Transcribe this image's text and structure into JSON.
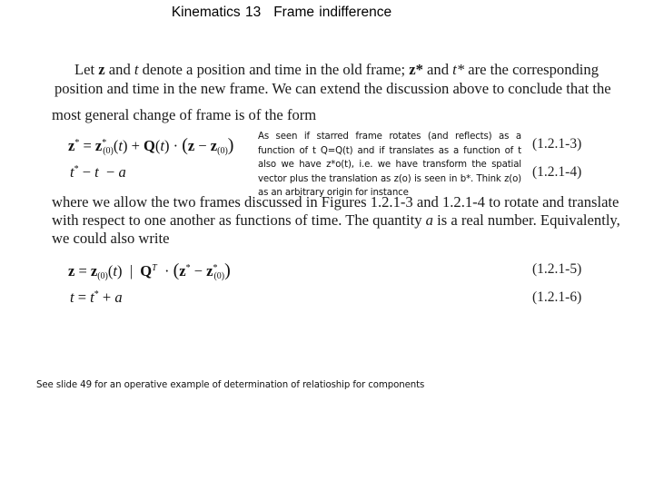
{
  "slide": {
    "title_left": "Kinematics 13",
    "title_right": "Frame indifference"
  },
  "body": {
    "paragraph1_line1": "Let z and t denote a position and time in the old frame; z* and t* are the corresponding",
    "paragraph1_line1_parts": {
      "a": "Let ",
      "z": "z",
      "b": " and ",
      "t": "t",
      "c": " denote a position and time in the old frame; ",
      "zs": "z*",
      "d": " and ",
      "ts": "t*",
      "e": " are the corresponding"
    },
    "paragraph1_line2": "position and time in the new frame. We can extend the discussion above to conclude that the",
    "paragraph1_line3": "most general change of frame is of the form",
    "paragraph2_line1_parts": {
      "a": "where we allow the two frames discussed in Figures 1.2.1-3 and 1.2.1-4 to rotate and translate"
    },
    "paragraph2_line2_parts": {
      "a": "with respect to one another as functions of time. The quantity ",
      "alpha": "a",
      "b": " is a real number. Equivalently,"
    },
    "paragraph2_line3": "we could also write"
  },
  "equations": [
    {
      "id": "eq-1-2-1-3",
      "number": "(1.2.1-3)",
      "latex": "z* = z*_(0)(t) + Q(t) · (z − z_(0))"
    },
    {
      "id": "eq-1-2-1-4",
      "number": "(1.2.1-4)",
      "latex": "t* = t − a"
    },
    {
      "id": "eq-1-2-1-5",
      "number": "(1.2.1-5)",
      "latex": "z = z_(0)(t) + Q^T · (z* − z*_(0))"
    },
    {
      "id": "eq-1-2-1-6",
      "number": "(1.2.1-6)",
      "latex": "t = t* + a"
    }
  ],
  "annotation": {
    "text": "As seen if  starred frame rotates (and reflects) as a function of t Q=Q(t) and if translates as a function of t also we have z*o(t), i.e. we have transform the spatial vector plus the translation as z(o) is seen in b*. Think z(o) as an arbitrary origin for instance"
  },
  "footer": {
    "text": "See slide 49 for an operative example of determination of relatioship for components"
  }
}
